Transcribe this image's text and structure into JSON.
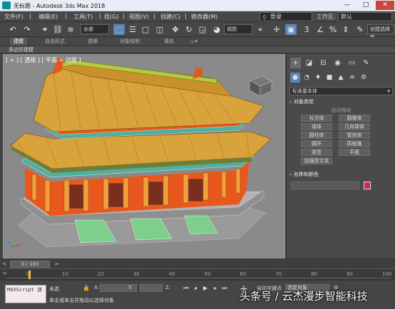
{
  "window": {
    "title": "无标题 - Autodesk 3ds Max 2018",
    "controls": [
      "—",
      "□",
      "✕"
    ]
  },
  "menu": {
    "items": [
      "文件(F)",
      "编辑(E)",
      "工具(T)",
      "组(G)",
      "视图(V)",
      "创建(C)",
      "修改器(M)"
    ],
    "search_value": "登录",
    "workspace_label": "工作区:",
    "workspace_value": "默认"
  },
  "toolbar": {
    "selection_filter": "全部",
    "ref_coord": "视图",
    "named_selection": "创建选择集"
  },
  "ribbon": {
    "tabs": [
      "建模",
      "自由形式",
      "选择",
      "对象绘制",
      "填充"
    ],
    "sub_label": "多边形建模"
  },
  "viewport": {
    "label": "[ + ] [ 透视 ] [ 平面 + 边面 ]"
  },
  "command_panel": {
    "category_dropdown": "标准基本体",
    "object_type_header": "对象类型",
    "autogrid_label": "自动栅格",
    "object_buttons": [
      "长方体",
      "圆锥体",
      "球体",
      "几何球体",
      "圆柱体",
      "管状体",
      "圆环",
      "四棱锥",
      "茶壶",
      "平面",
      "加强型文本"
    ],
    "name_color_header": "名称和颜色",
    "object_color": "#c8256d"
  },
  "timeline": {
    "frame_display": "0 / 100",
    "current_frame": 0,
    "total_frames": 100,
    "ticks": [
      "0",
      "10",
      "20",
      "30",
      "40",
      "50",
      "60",
      "70",
      "80",
      "90",
      "100"
    ]
  },
  "status": {
    "maxscript_label": "MAXScript 迷",
    "status_line1": "未选",
    "status_line2": "单击或单击并拖动以选择对象",
    "x_label": "X:",
    "y_label": "Y:",
    "z_label": "Z:",
    "autokey_label": "自动关键点",
    "set_key_filter": "选定对象",
    "set_key_label": "设置关键点",
    "key_filter_label": "关键点过滤器..."
  },
  "watermark": "头条号 / 云杰漫步智能科技"
}
